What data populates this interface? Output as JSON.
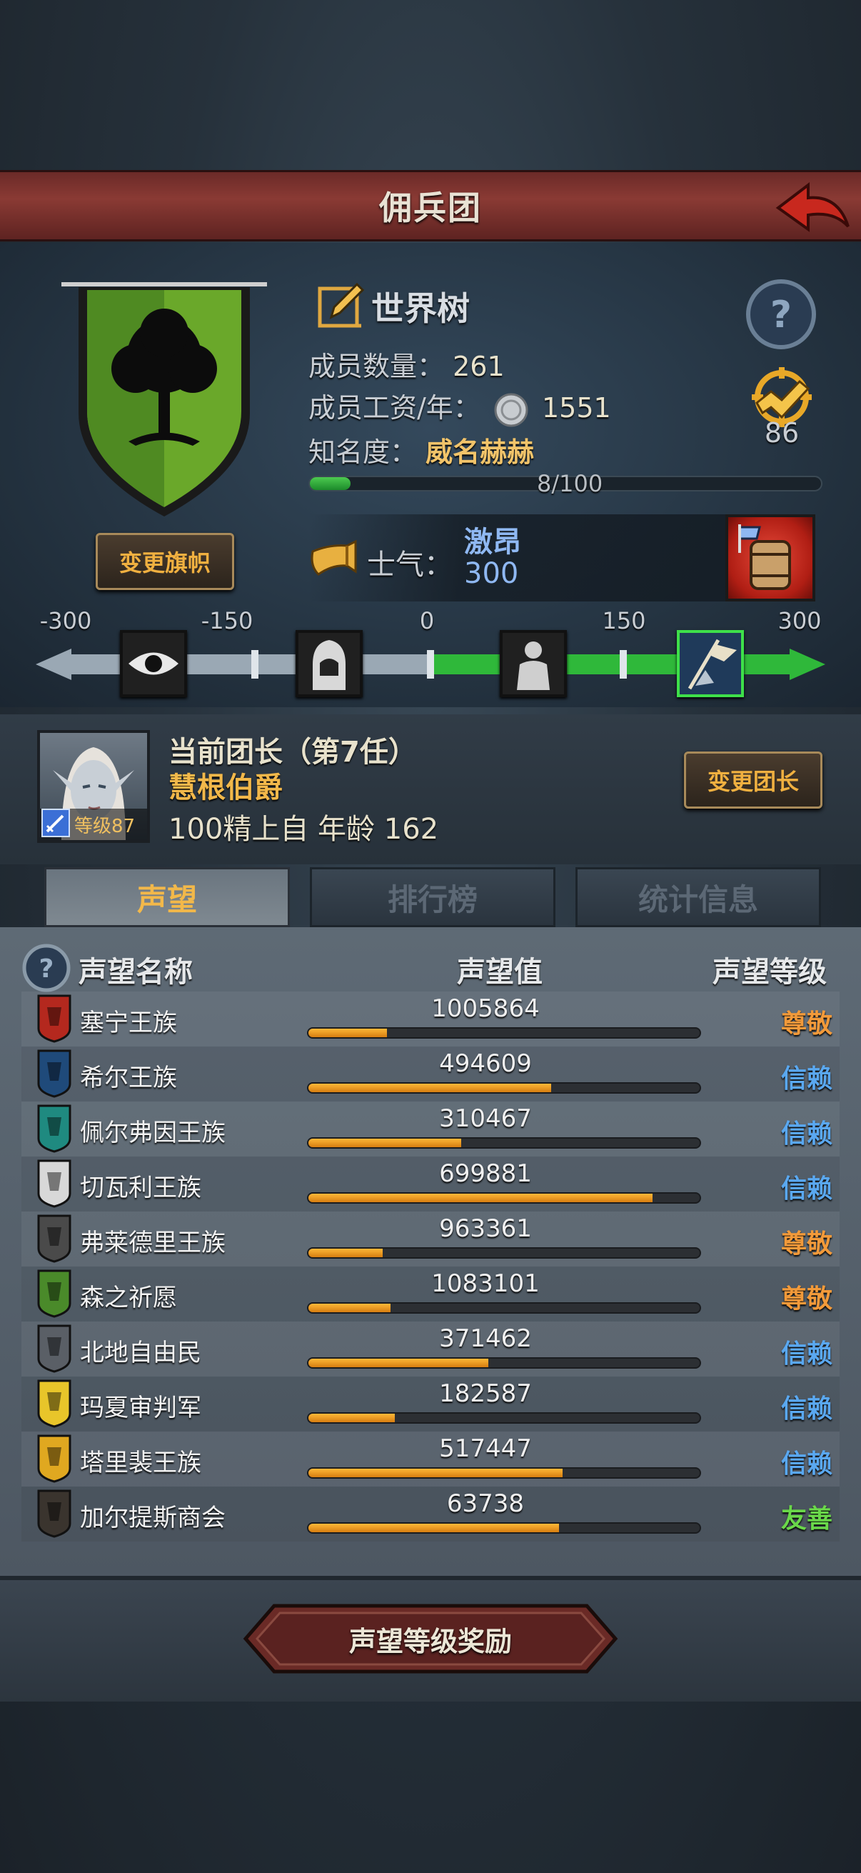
{
  "header": {
    "title": "佣兵团"
  },
  "guild": {
    "name": "世界树",
    "members_label": "成员数量：",
    "members_value": "261",
    "wage_label": "成员工资/年：",
    "wage_value": "1551",
    "fame_label": "知名度：",
    "fame_title": "威名赫赫",
    "fame_progress": "8/100",
    "fame_fraction": 0.08,
    "badge_value": "86",
    "change_flag_label": "变更旗帜"
  },
  "morale": {
    "label": "士气：",
    "state": "激昂",
    "value": "300",
    "scale_labels": [
      "-300",
      "-150",
      "0",
      "150",
      "300"
    ],
    "icons": [
      "eye-icon",
      "hooded-figure-icon",
      "figure-icon",
      "charge-flag-icon"
    ]
  },
  "leader": {
    "title": "当前团长（第7任）",
    "name": "慧根伯爵",
    "info": "100精上自  年龄 162",
    "level": "等级87",
    "change_label": "变更团长"
  },
  "tabs": [
    {
      "label": "声望"
    },
    {
      "label": "排行榜"
    },
    {
      "label": "统计信息"
    }
  ],
  "reputation": {
    "headers": {
      "name": "声望名称",
      "value": "声望值",
      "level": "声望等级"
    },
    "rows": [
      {
        "name": "塞宁王族",
        "value": "1005864",
        "fill": 0.2,
        "level": "尊敬",
        "level_color": "#f29a3a",
        "emblem_color": "#b4281e"
      },
      {
        "name": "希尔王族",
        "value": "494609",
        "fill": 0.62,
        "level": "信赖",
        "level_color": "#5aa8f0",
        "emblem_color": "#1f4a7a"
      },
      {
        "name": "佩尔弗因王族",
        "value": "310467",
        "fill": 0.39,
        "level": "信赖",
        "level_color": "#5aa8f0",
        "emblem_color": "#1f8a80"
      },
      {
        "name": "切瓦利王族",
        "value": "699881",
        "fill": 0.88,
        "level": "信赖",
        "level_color": "#5aa8f0",
        "emblem_color": "#d8d8d8"
      },
      {
        "name": "弗莱德里王族",
        "value": "963361",
        "fill": 0.19,
        "level": "尊敬",
        "level_color": "#f29a3a",
        "emblem_color": "#4a4a4a"
      },
      {
        "name": "森之祈愿",
        "value": "1083101",
        "fill": 0.21,
        "level": "尊敬",
        "level_color": "#f29a3a",
        "emblem_color": "#4a8a2a"
      },
      {
        "name": "北地自由民",
        "value": "371462",
        "fill": 0.46,
        "level": "信赖",
        "level_color": "#5aa8f0",
        "emblem_color": "#5a5f66"
      },
      {
        "name": "玛夏审判军",
        "value": "182587",
        "fill": 0.22,
        "level": "信赖",
        "level_color": "#5aa8f0",
        "emblem_color": "#e8c52a"
      },
      {
        "name": "塔里裴王族",
        "value": "517447",
        "fill": 0.65,
        "level": "信赖",
        "level_color": "#5aa8f0",
        "emblem_color": "#e0a820"
      },
      {
        "name": "加尔提斯商会",
        "value": "63738",
        "fill": 0.64,
        "level": "友善",
        "level_color": "#6ad84a",
        "emblem_color": "#3a342e"
      }
    ]
  },
  "footer": {
    "reward_label": "声望等级奖励"
  }
}
